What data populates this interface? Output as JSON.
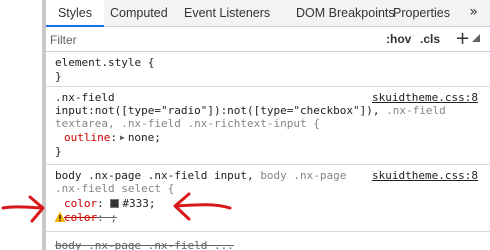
{
  "tabs": [
    {
      "label": "Styles",
      "active": true
    },
    {
      "label": "Computed",
      "active": false
    },
    {
      "label": "Event Listeners",
      "active": false
    },
    {
      "label": "DOM Breakpoints",
      "active": false
    },
    {
      "label": "Properties",
      "active": false
    }
  ],
  "tab_overflow": "»",
  "filter": {
    "placeholder": "Filter",
    "value": ""
  },
  "filter_buttons": {
    "hov": ":hov",
    "cls": ".cls",
    "add": "+"
  },
  "rules": {
    "element_style": {
      "selector": "element.style {",
      "close": "}"
    },
    "nx_field": {
      "selector_line1": ".nx-field",
      "selector_line2_a": "input:not([type=\"radio\"]):not([type=\"checkbox\"]),",
      "selector_line2_b": ".nx-field",
      "selector_line3": "textarea, .nx-field .nx-richtext-input {",
      "source": "skuidtheme.css:8",
      "prop": "outline",
      "value": "none;",
      "close": "}"
    },
    "body_page": {
      "selector_a": "body .nx-page .nx-field input,",
      "selector_b": "body .nx-page",
      "selector_line2": ".nx-field select {",
      "source": "skuidtheme.css:8",
      "prop1": "color",
      "value1": "#333;",
      "prop2": "color",
      "value2": ";",
      "close": "}"
    },
    "partial_next": "body .nx-page .nx-field ..."
  },
  "colors": {
    "tab_underline": "#1a73e8",
    "property_name": "#c80000",
    "swatch": "#333333",
    "annotation_arrow": "#d7191c",
    "warning": "#f2b300"
  }
}
